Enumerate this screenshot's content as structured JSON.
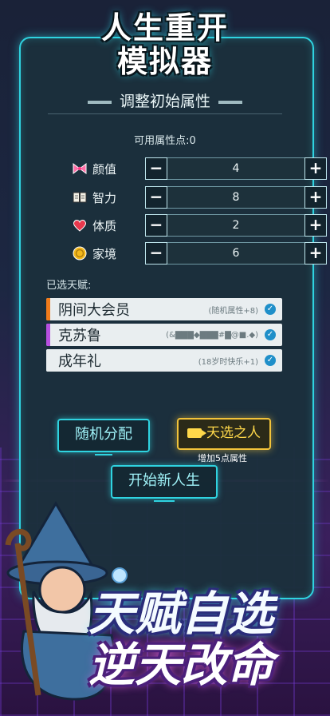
{
  "header": {
    "title_line1": "人生重开",
    "title_line2": "模拟器"
  },
  "panel": {
    "subtitle": "调整初始属性",
    "points_label": "可用属性点:0"
  },
  "attributes": [
    {
      "icon": "bow-icon",
      "label": "颜值",
      "value": "4"
    },
    {
      "icon": "book-icon",
      "label": "智力",
      "value": "8"
    },
    {
      "icon": "heart-icon",
      "label": "体质",
      "value": "2"
    },
    {
      "icon": "coin-icon",
      "label": "家境",
      "value": "6"
    }
  ],
  "stepper": {
    "minus": "−",
    "plus": "+"
  },
  "talents": {
    "section_label": "已选天赋:",
    "items": [
      {
        "name": "阴间大会员",
        "desc": "(随机属性+8)",
        "bar_color": "#f07a1a"
      },
      {
        "name": "克苏鲁",
        "desc": "(&▇▇▇◆▇▇▇#▇@■.◆)",
        "bar_color": "#b74fe0"
      },
      {
        "name": "成年礼",
        "desc": "(18岁时快乐+1)",
        "bar_color": "#e9eef0"
      }
    ]
  },
  "actions": {
    "random_label": "随机分配",
    "chosen_label": "天选之人",
    "chosen_sub": "增加5点属性",
    "start_label": "开始新人生"
  },
  "promo": {
    "line1": "天赋自选",
    "line2": "逆天改命"
  },
  "colors": {
    "accent": "#2fd3e0",
    "gold": "#f2c33a"
  }
}
